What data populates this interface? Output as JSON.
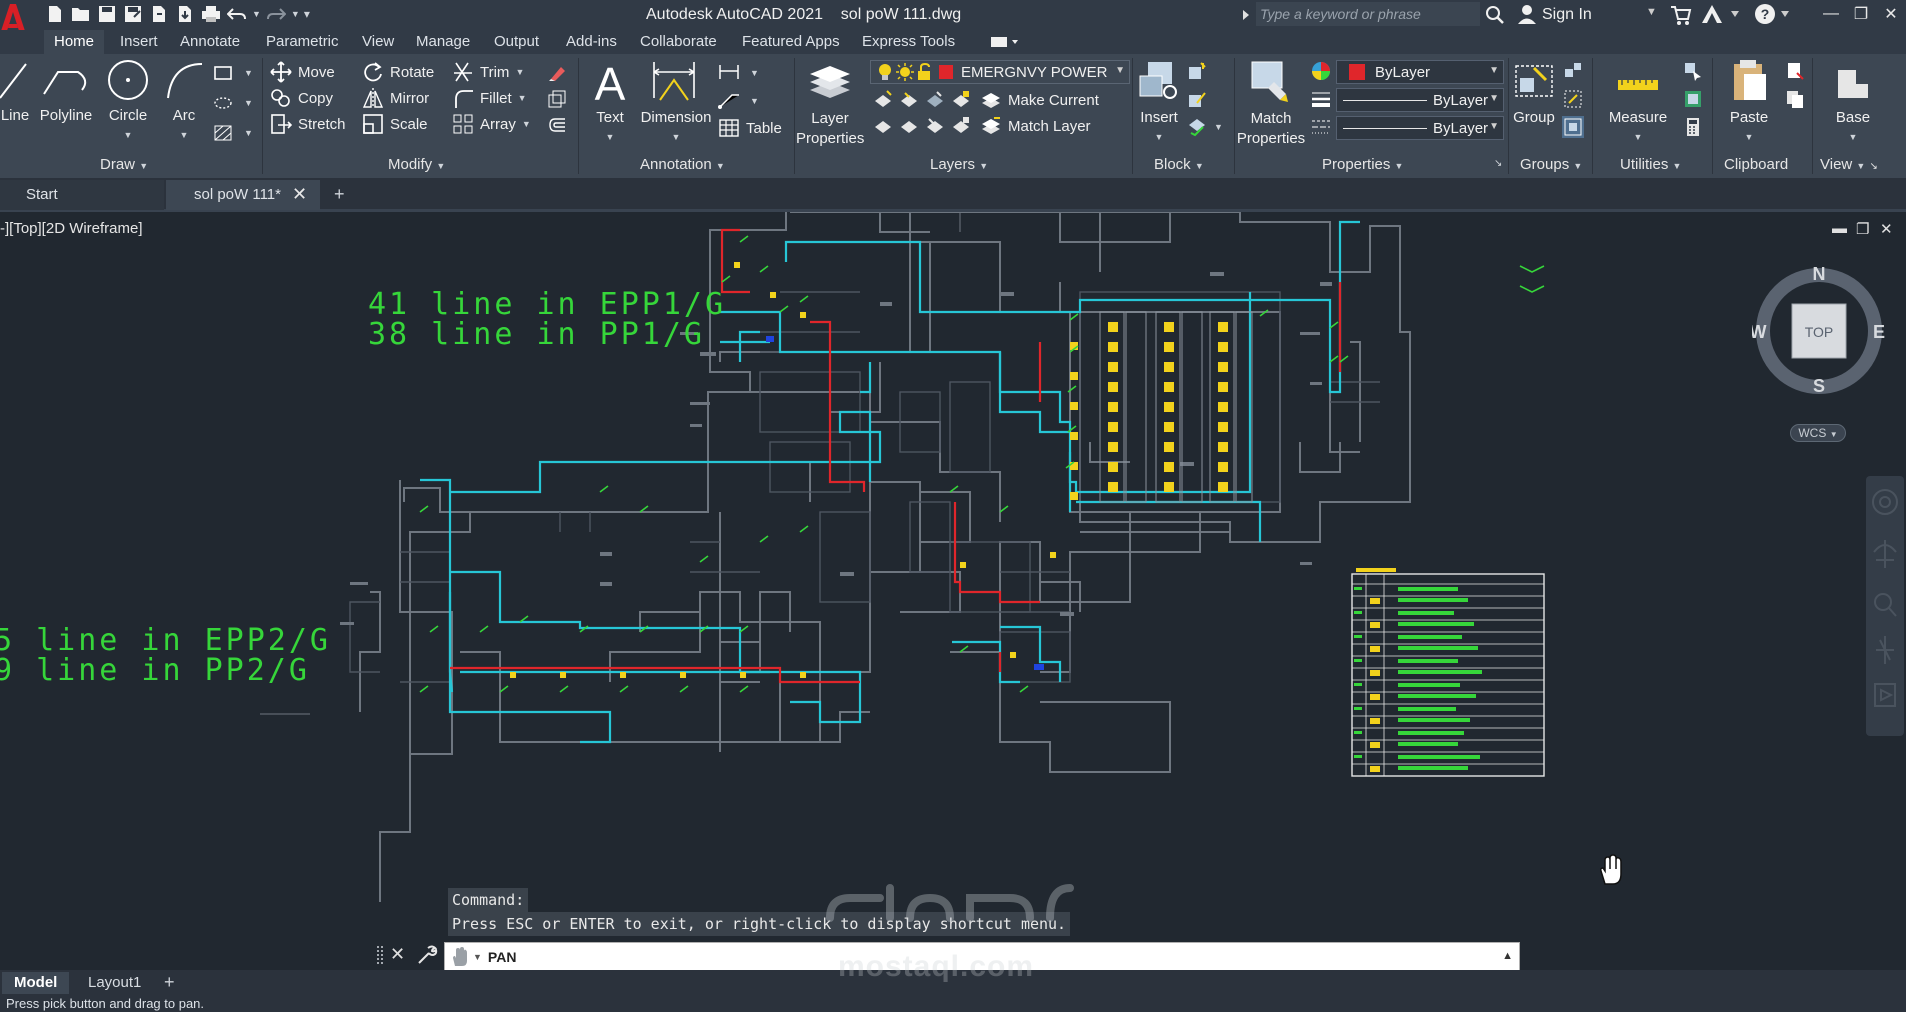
{
  "app": {
    "title": "Autodesk AutoCAD 2021    sol poW 111.dwg",
    "search_placeholder": "Type a keyword or phrase",
    "sign_in": "Sign In"
  },
  "ribbon_tabs": [
    "Home",
    "Insert",
    "Annotate",
    "Parametric",
    "View",
    "Manage",
    "Output",
    "Add-ins",
    "Collaborate",
    "Featured Apps",
    "Express Tools"
  ],
  "panels": {
    "draw": {
      "title": "Draw",
      "line": "Line",
      "polyline": "Polyline",
      "circle": "Circle",
      "arc": "Arc"
    },
    "modify": {
      "title": "Modify",
      "move": "Move",
      "rotate": "Rotate",
      "trim": "Trim",
      "copy": "Copy",
      "mirror": "Mirror",
      "fillet": "Fillet",
      "stretch": "Stretch",
      "scale": "Scale",
      "array": "Array"
    },
    "annotation": {
      "title": "Annotation",
      "text": "Text",
      "dimension": "Dimension",
      "table": "Table"
    },
    "layers": {
      "title": "Layers",
      "layer_properties": "Layer Properties",
      "current_layer": "EMERGNVY POWER",
      "make_current": "Make Current",
      "match_layer": "Match Layer"
    },
    "block": {
      "title": "Block",
      "insert": "Insert"
    },
    "properties": {
      "title": "Properties",
      "match_properties": "Match Properties",
      "color": "ByLayer",
      "linetype": "ByLayer",
      "lineweight": "ByLayer"
    },
    "groups": {
      "title": "Groups",
      "group": "Group"
    },
    "utilities": {
      "title": "Utilities",
      "measure": "Measure"
    },
    "clipboard": {
      "title": "Clipboard",
      "paste": "Paste"
    },
    "view": {
      "title": "View",
      "base": "Base"
    }
  },
  "doc_tabs": {
    "start": "Start",
    "drawing": "sol poW 111*"
  },
  "viewport": {
    "label": "-][Top][2D Wireframe]"
  },
  "annotations": {
    "block1_line1": "41 line in EPP1/G",
    "block1_line2": "38 line in PP1/G",
    "block2_line1": "5 line in EPP2/G",
    "block2_line2": "9 line in PP2/G"
  },
  "viewcube": {
    "n": "N",
    "s": "S",
    "e": "E",
    "w": "W",
    "face": "TOP",
    "wcs": "WCS"
  },
  "command": {
    "history1": "Command:",
    "history2": "Press ESC or ENTER to exit, or right-click to display shortcut menu.",
    "prompt": "PAN"
  },
  "layout_tabs": {
    "model": "Model",
    "layout1": "Layout1"
  },
  "status_text": "Press pick button and drag to pan.",
  "watermark": {
    "text": "mostaql.com"
  },
  "colors": {
    "cyan_wire": "#27c6d6",
    "red_wire": "#e0262b",
    "green_text": "#36d63a",
    "yellow_device": "#f2d21c",
    "walls": "#6e7680"
  }
}
